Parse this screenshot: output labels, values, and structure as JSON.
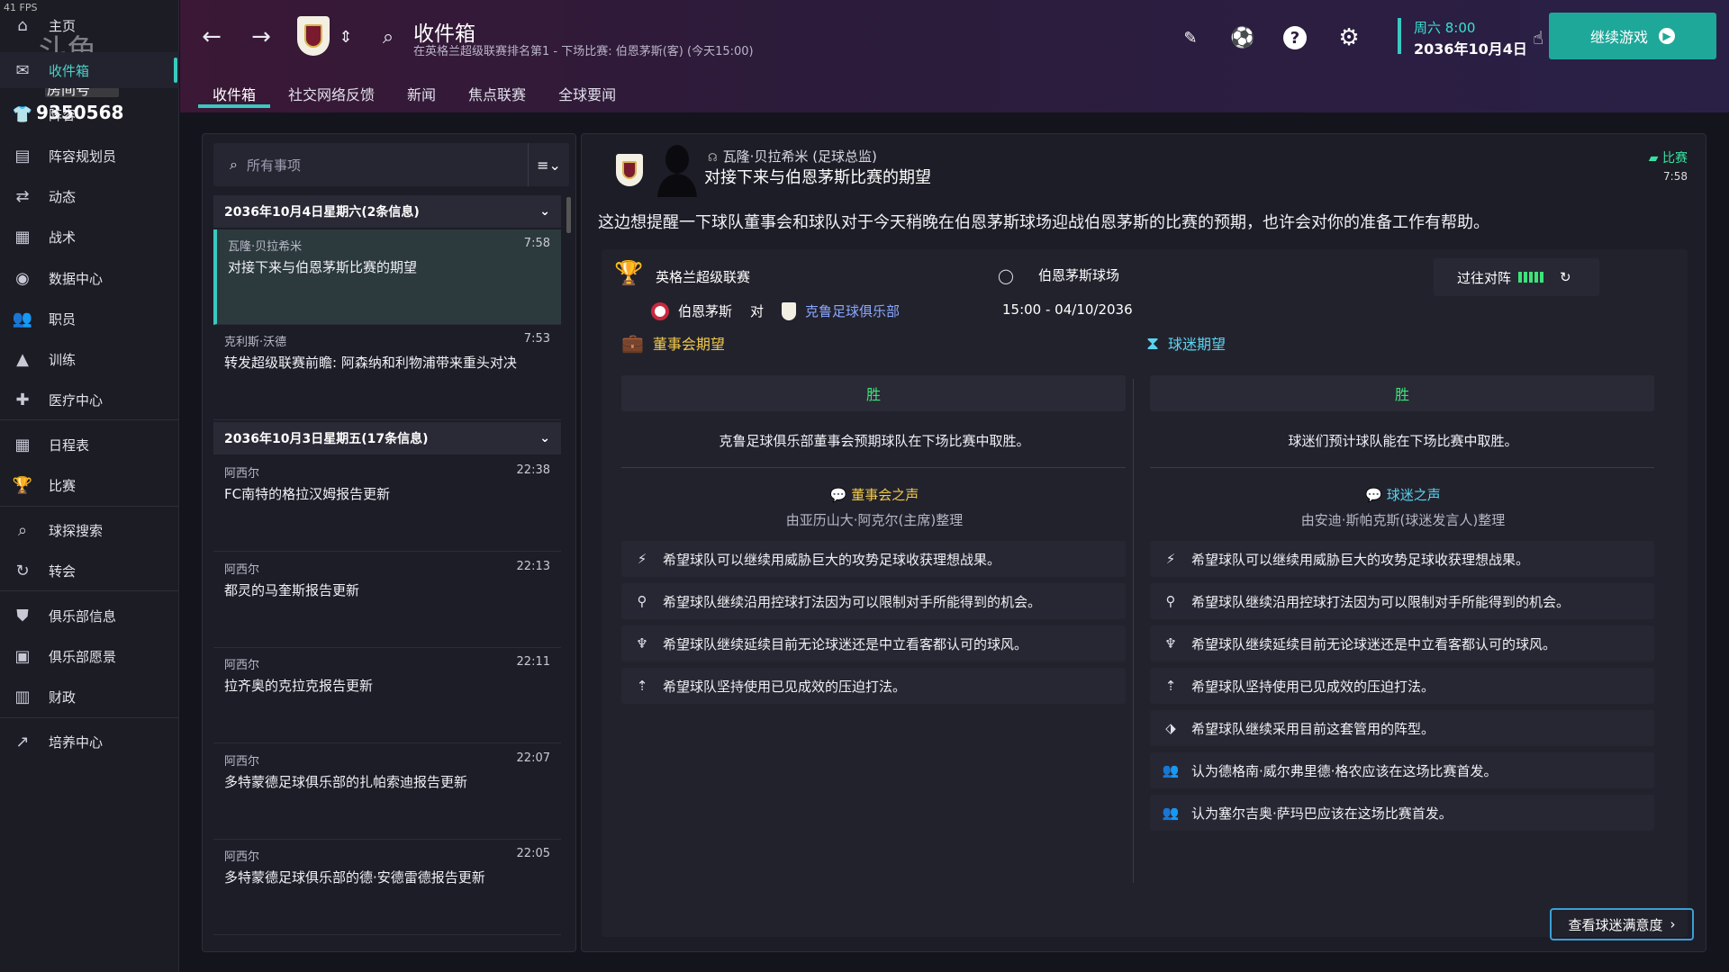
{
  "fps": "41 FPS",
  "room": {
    "label": "房间号",
    "number": "9350568",
    "watermark": "斗鱼"
  },
  "sidebar": {
    "items": [
      {
        "label": "主页",
        "icon": "home-icon"
      },
      {
        "label": "收件箱",
        "icon": "inbox-icon"
      },
      {
        "label": "阵容",
        "icon": "squad-icon"
      },
      {
        "label": "阵容规划员",
        "icon": "clipboard-icon"
      },
      {
        "label": "动态",
        "icon": "dynamics-icon"
      },
      {
        "label": "战术",
        "icon": "tactics-icon"
      },
      {
        "label": "数据中心",
        "icon": "data-hub-icon"
      },
      {
        "label": "职员",
        "icon": "staff-icon"
      },
      {
        "label": "训练",
        "icon": "training-icon"
      },
      {
        "label": "医疗中心",
        "icon": "medical-icon"
      },
      {
        "label": "日程表",
        "icon": "calendar-icon"
      },
      {
        "label": "比赛",
        "icon": "trophy-icon"
      },
      {
        "label": "球探搜索",
        "icon": "scouting-icon"
      },
      {
        "label": "转会",
        "icon": "transfer-icon"
      },
      {
        "label": "俱乐部信息",
        "icon": "club-info-icon"
      },
      {
        "label": "俱乐部愿景",
        "icon": "club-vision-icon"
      },
      {
        "label": "财政",
        "icon": "finance-icon"
      },
      {
        "label": "培养中心",
        "icon": "development-icon"
      }
    ]
  },
  "header": {
    "title": "收件箱",
    "subtitle": "在英格兰超级联赛排名第1 - 下场比赛: 伯恩茅斯(客) (今天15:00)",
    "tabs": [
      "收件箱",
      "社交网络反馈",
      "新闻",
      "焦点联赛",
      "全球要闻"
    ],
    "date_day": "周六 8:00",
    "date_full": "2036年10月4日",
    "continue_label": "继续游戏"
  },
  "inbox": {
    "search_placeholder": "所有事项",
    "groups": [
      {
        "header": "2036年10月4日星期六(2条信息)",
        "messages": [
          {
            "from": "瓦隆·贝拉希米",
            "time": "7:58",
            "subject": "对接下来与伯恩茅斯比赛的期望"
          },
          {
            "from": "克利斯·沃德",
            "time": "7:53",
            "subject": "转发超级联赛前瞻: 阿森纳和利物浦带来重头对决"
          }
        ]
      },
      {
        "header": "2036年10月3日星期五(17条信息)",
        "messages": [
          {
            "from": "阿西尔",
            "time": "22:38",
            "subject": "FC南特的格拉汉姆报告更新"
          },
          {
            "from": "阿西尔",
            "time": "22:13",
            "subject": "都灵的马奎斯报告更新"
          },
          {
            "from": "阿西尔",
            "time": "22:11",
            "subject": "拉齐奥的克拉克报告更新"
          },
          {
            "from": "阿西尔",
            "time": "22:07",
            "subject": "多特蒙德足球俱乐部的扎帕索迪报告更新"
          },
          {
            "from": "阿西尔",
            "time": "22:05",
            "subject": "多特蒙德足球俱乐部的德·安德雷德报告更新"
          }
        ]
      }
    ]
  },
  "detail": {
    "sender": "瓦隆·贝拉希米 (足球总监)",
    "subject": "对接下来与伯恩茅斯比赛的期望",
    "tag": "比赛",
    "time": "7:58",
    "body": "这边想提醒一下球队董事会和球队对于今天稍晚在伯恩茅斯球场迎战伯恩茅斯的比赛的预期，也许会对你的准备工作有帮助。",
    "competition": "英格兰超级联赛",
    "venue": "伯恩茅斯球场",
    "home_team": "伯恩茅斯",
    "vs": "对",
    "away_team": "克鲁足球俱乐部",
    "kickoff": "15:00 - 04/10/2036",
    "form_label": "过往对阵",
    "board": {
      "title": "董事会期望",
      "result": "胜",
      "desc": "克鲁足球俱乐部董事会预期球队在下场比赛中取胜。",
      "voice_title": "董事会之声",
      "voice_by": "由亚历山大·阿克尔(主席)整理",
      "items": [
        "希望球队可以继续用威胁巨大的攻势足球收获理想战果。",
        "希望球队继续沿用控球打法因为可以限制对手所能得到的机会。",
        "希望球队继续延续目前无论球迷还是中立看客都认可的球风。",
        "希望球队坚持使用已见成效的压迫打法。"
      ]
    },
    "fans": {
      "title": "球迷期望",
      "result": "胜",
      "desc": "球迷们预计球队能在下场比赛中取胜。",
      "voice_title": "球迷之声",
      "voice_by": "由安迪·斯帕克斯(球迷发言人)整理",
      "items": [
        "希望球队可以继续用威胁巨大的攻势足球收获理想战果。",
        "希望球队继续沿用控球打法因为可以限制对手所能得到的机会。",
        "希望球队继续延续目前无论球迷还是中立看客都认可的球风。",
        "希望球队坚持使用已见成效的压迫打法。",
        "希望球队继续采用目前这套管用的阵型。",
        "认为德格南·威尔弗里德·格农应该在这场比赛首发。",
        "认为塞尔吉奥·萨玛巴应该在这场比赛首发。"
      ]
    },
    "view_button": "查看球迷满意度"
  },
  "colors": {
    "accent": "#39c9c0",
    "win": "#3de37a",
    "board": "#f1c94a",
    "fans": "#5ad4f0",
    "link": "#8ba8ff"
  }
}
